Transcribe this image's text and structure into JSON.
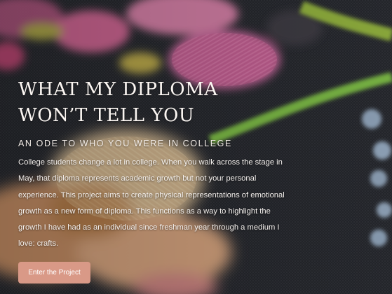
{
  "hero": {
    "title_line1": "WHAT MY DIPLOMA",
    "title_line2": "WON’T TELL YOU",
    "subtitle": "AN ODE TO WHO YOU WERE IN COLLEGE",
    "description": "College students change a lot in college. When you walk across the stage in May, that diploma represents academic growth but not your personal experience. This project aims to create physical representations of emotional growth as a new form of diploma. This functions as a way to highlight the growth I have had as an individual since freshman year through a medium I love: crafts.",
    "cta_label": "Enter the Project"
  },
  "colors": {
    "button_bg": "#d99987",
    "text": "#ffffff"
  }
}
